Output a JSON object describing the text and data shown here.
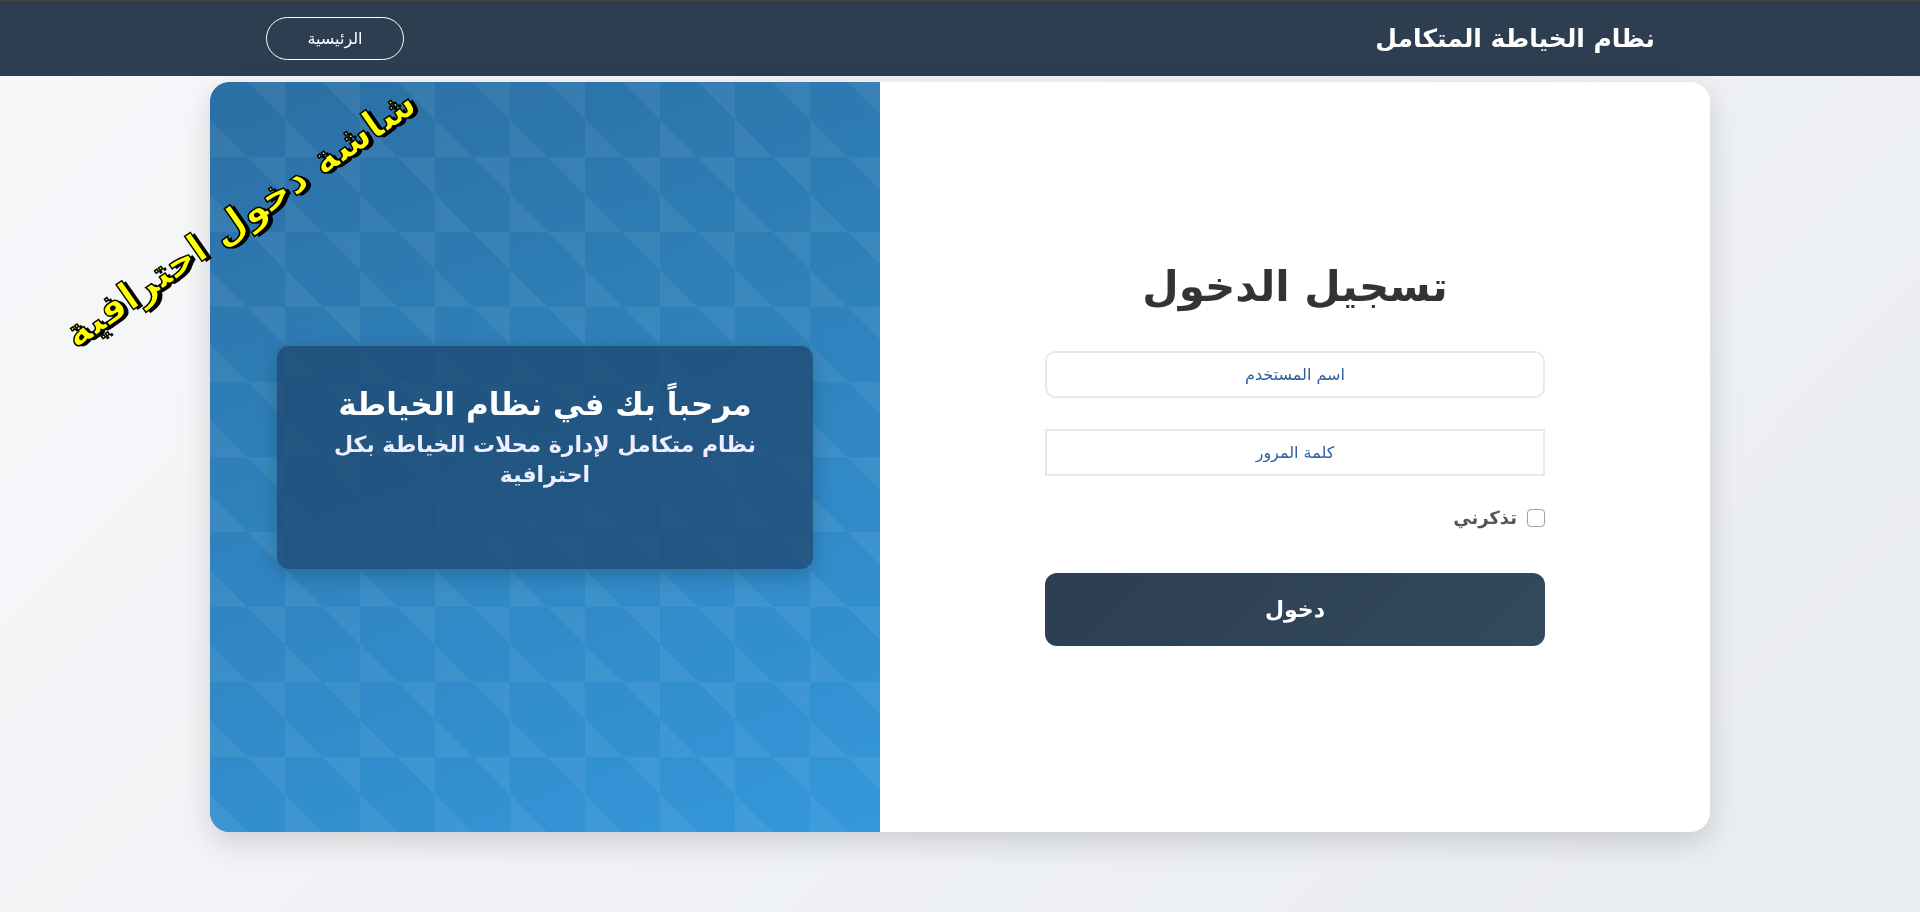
{
  "header": {
    "title": "نظام الخياطة المتكامل",
    "home_button": "الرئيسية"
  },
  "caption": "شاشة دخول احترافية",
  "login": {
    "title": "تسجيل الدخول",
    "fields": [
      {
        "placeholder": "اسم المستخدم",
        "kind": "text"
      },
      {
        "placeholder": "كلمة المرور",
        "kind": "password"
      }
    ],
    "remember": {
      "label": "تذكرني",
      "checked": false
    },
    "submit": "دخول"
  },
  "welcome": {
    "title": "مرحباً بك في نظام الخياطة",
    "subtitle": "نظام متكامل لإدارة محلات الخياطة بكل احترافية"
  }
}
